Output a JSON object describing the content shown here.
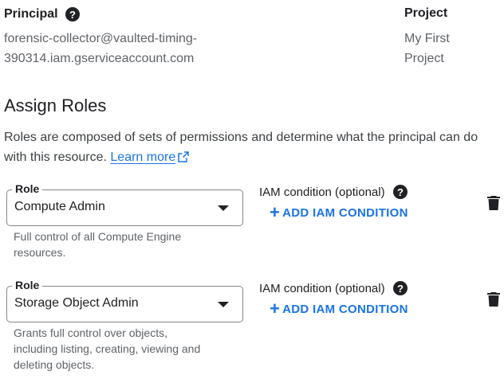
{
  "principal": {
    "title": "Principal",
    "value_line1": "forensic-collector@vaulted-timing-",
    "value_line2": "390314.iam.gserviceaccount.com"
  },
  "project": {
    "title": "Project",
    "value_line1": "My First",
    "value_line2": "Project"
  },
  "assign_roles": {
    "title": "Assign Roles",
    "description": "Roles are composed of sets of permissions and determine what the principal can do with this resource.",
    "learn_more": "Learn more"
  },
  "roles": [
    {
      "field_label": "Role",
      "value": "Compute Admin",
      "hint": "Full control of all Compute Engine resources.",
      "iam_label": "IAM condition (optional)",
      "add_condition": "ADD IAM CONDITION"
    },
    {
      "field_label": "Role",
      "value": "Storage Object Admin",
      "hint": "Grants full control over objects, including listing, creating, viewing and deleting objects.",
      "iam_label": "IAM condition (optional)",
      "add_condition": "ADD IAM CONDITION"
    }
  ],
  "icons": {
    "help": "help-circle-icon",
    "external": "external-link-icon",
    "dropdown": "dropdown-arrow-icon",
    "delete": "trash-icon"
  },
  "colors": {
    "link": "#1a73e8",
    "text": "#202124",
    "secondary": "#5f6368",
    "border": "#80868b"
  }
}
